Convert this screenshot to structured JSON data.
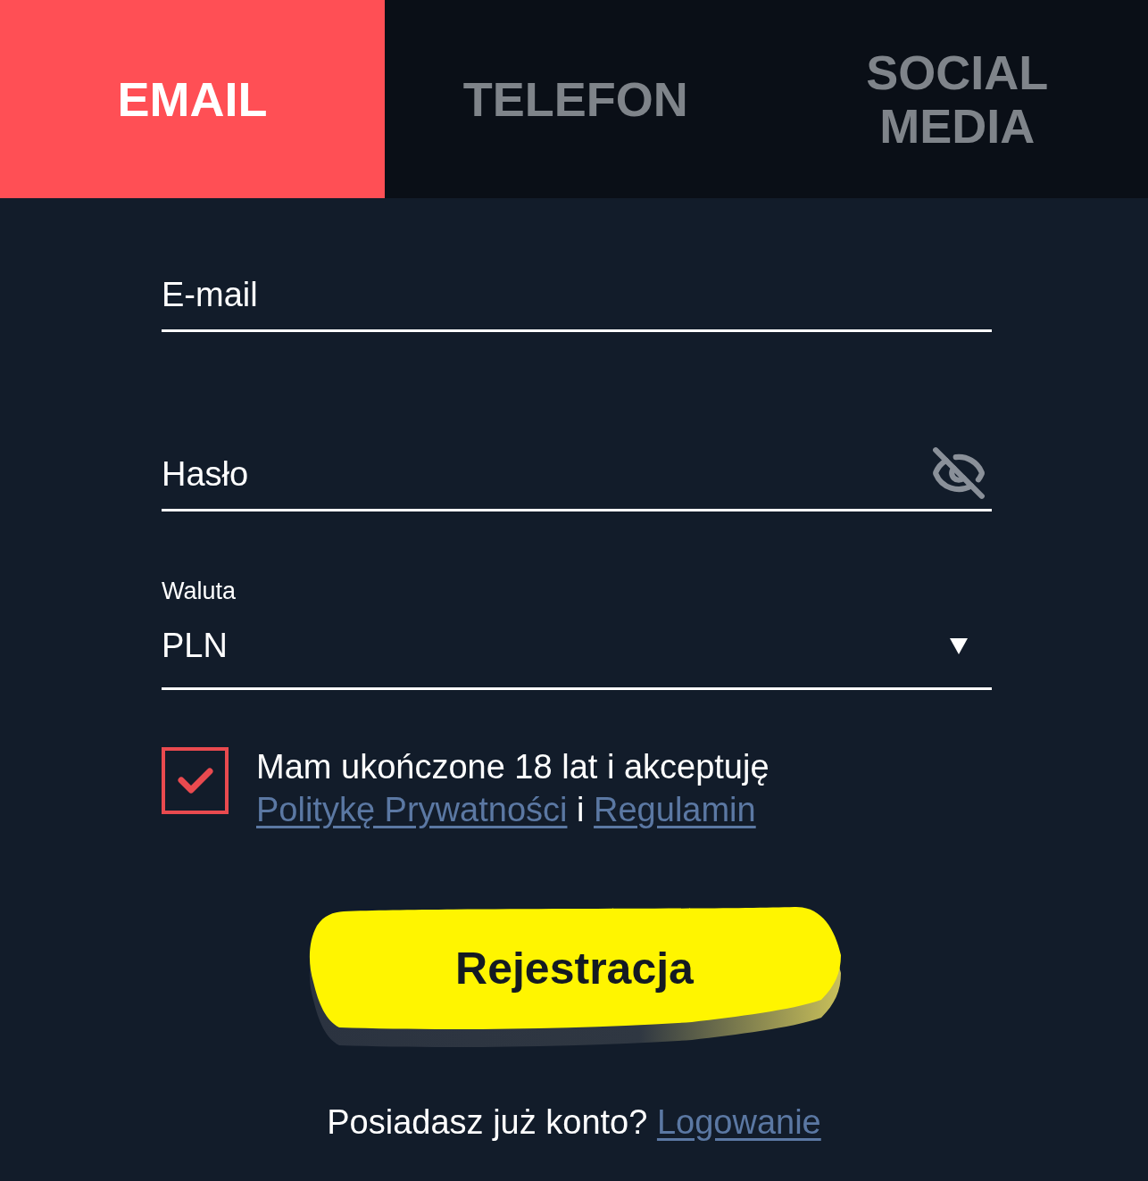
{
  "tabs": [
    {
      "label": "EMAIL",
      "selected": true
    },
    {
      "label": "TELEFON",
      "selected": false
    },
    {
      "label": "SOCIAL MEDIA",
      "selected": false
    }
  ],
  "email_field": {
    "placeholder": "E-mail"
  },
  "password_field": {
    "placeholder": "Hasło",
    "show_password": false
  },
  "currency": {
    "label": "Waluta",
    "value": "PLN"
  },
  "consent": {
    "checked": true,
    "parts": [
      {
        "kind": "text",
        "text": "Mam ukończone 18 lat i akceptuję"
      },
      {
        "kind": "link",
        "text": "Politykę Prywatności"
      },
      {
        "kind": "text",
        "text": "i"
      },
      {
        "kind": "link",
        "text": "Regulamin"
      }
    ]
  },
  "submit_button": {
    "label": "Rejestracja"
  },
  "login_prompt": {
    "text": "Posiadasz już konto?",
    "link": "Logowanie"
  }
}
